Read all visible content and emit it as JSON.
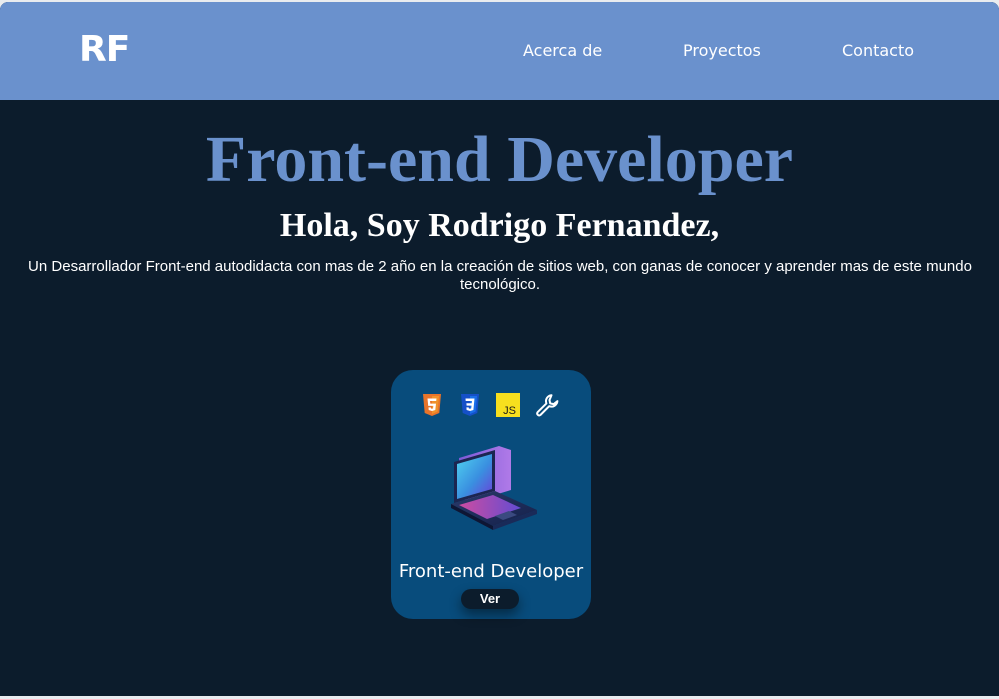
{
  "nav": {
    "logo": "RF",
    "links": [
      "Acerca de",
      "Proyectos",
      "Contacto"
    ]
  },
  "hero": {
    "title": "Front-end Developer",
    "greeting": "Hola, Soy Rodrigo Fernandez,",
    "description": "Un Desarrollador Front-end autodidacta con mas de 2 año en la creación de sitios web, con ganas de conocer y aprender mas de este mundo tecnológico."
  },
  "card": {
    "icons": [
      "html5-icon",
      "css3-icon",
      "js-icon",
      "wrench-icon"
    ],
    "js_label": "JS",
    "title": "Front-end Developer",
    "button_label": "Ver"
  },
  "colors": {
    "nav_background": "#6a91cd",
    "page_background": "#0c1c2c",
    "accent": "#6a91cd",
    "card_background": "#084c7c",
    "button_background": "#0c1c2c",
    "html_orange": "#f0922c",
    "css_blue": "#1a6fe8",
    "js_yellow": "#f7df1e"
  }
}
